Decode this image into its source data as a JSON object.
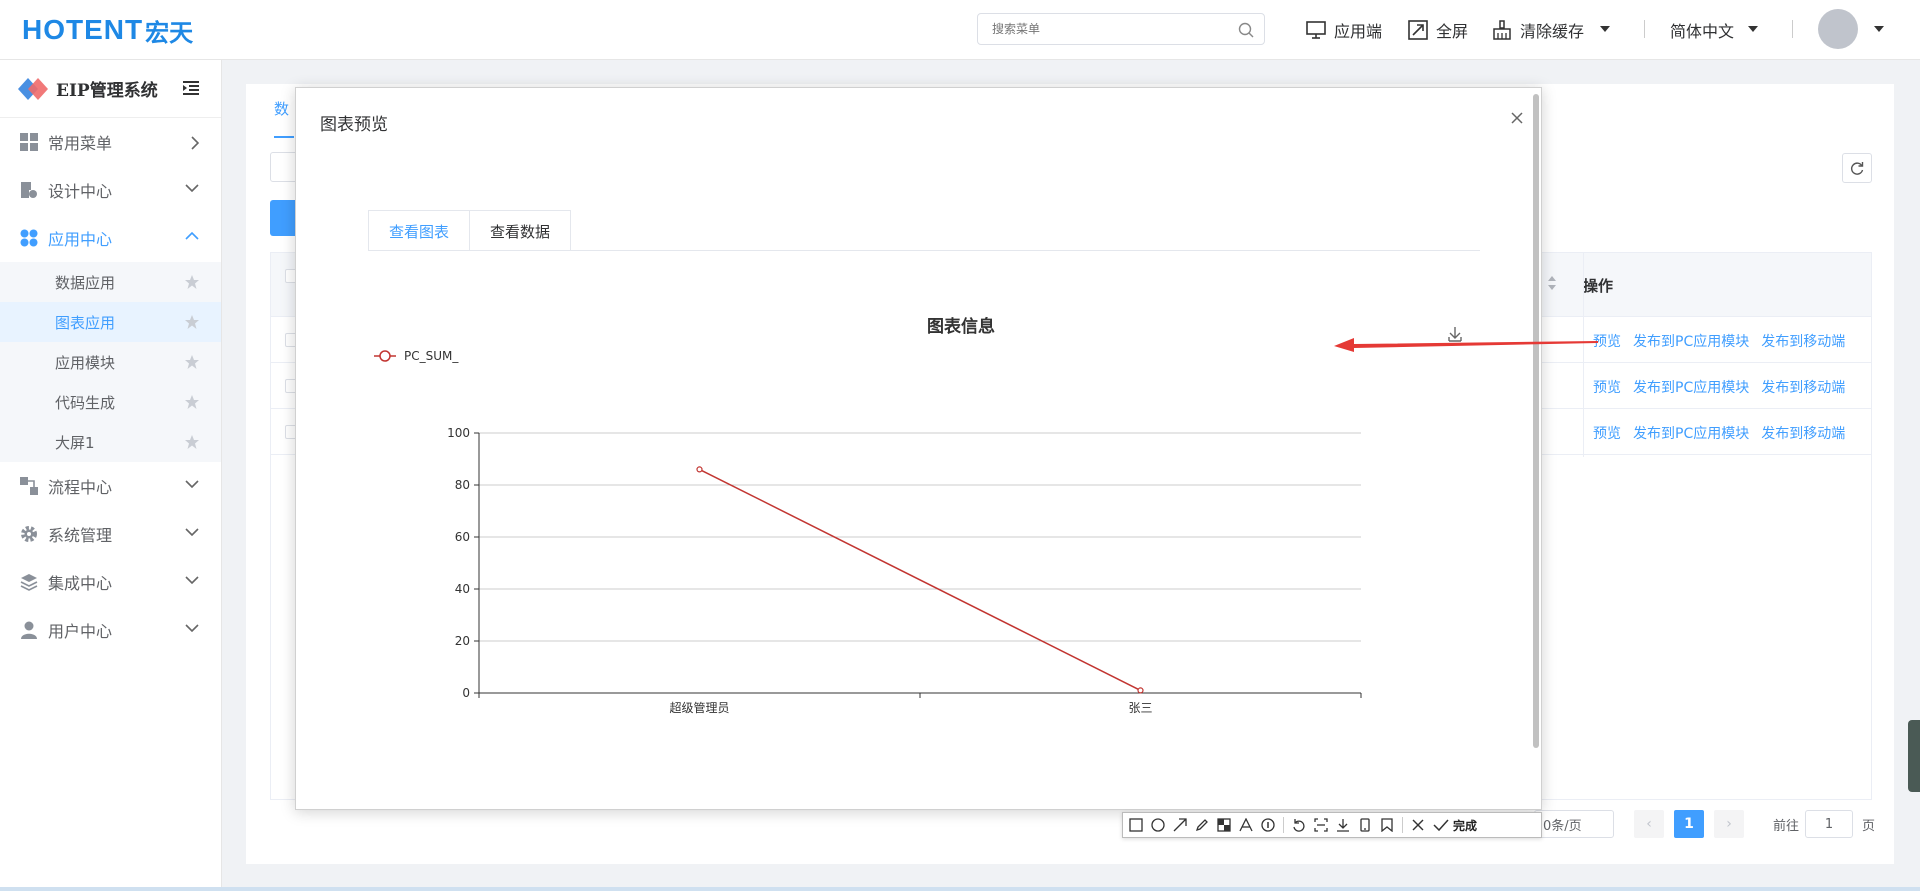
{
  "header": {
    "logo_brand": "HOTENT",
    "logo_cn": "宏天",
    "search_placeholder": "搜索菜单",
    "app_end": "应用端",
    "fullscreen": "全屏",
    "clear_cache": "清除缓存",
    "language": "简体中文"
  },
  "sidebar": {
    "system_title": "EIP管理系统",
    "menus": [
      {
        "label": "常用菜单",
        "icon": "dashboard-icon"
      },
      {
        "label": "设计中心",
        "icon": "design-doc-icon"
      },
      {
        "label": "应用中心",
        "icon": "app-grid-icon",
        "active": true
      },
      {
        "label": "流程中心",
        "icon": "flow-icon"
      },
      {
        "label": "系统管理",
        "icon": "gear-icon"
      },
      {
        "label": "集成中心",
        "icon": "layers-icon"
      },
      {
        "label": "用户中心",
        "icon": "user-icon"
      }
    ],
    "app_center_sub": [
      {
        "label": "数据应用"
      },
      {
        "label": "图表应用",
        "active": true
      },
      {
        "label": "应用模块"
      },
      {
        "label": "代码生成"
      },
      {
        "label": "大屏1"
      }
    ]
  },
  "main": {
    "tab_partial": "数",
    "ops_header": "操作",
    "rows": [
      {
        "preview": "预览",
        "publish_pc": "发布到PC应用模块",
        "publish_mobile": "发布到移动端"
      },
      {
        "preview": "预览",
        "publish_pc": "发布到PC应用模块",
        "publish_mobile": "发布到移动端"
      },
      {
        "preview": "预览",
        "publish_pc": "发布到PC应用模块",
        "publish_mobile": "发布到移动端"
      }
    ],
    "pagination": {
      "page_size": "0条/页",
      "current_page": "1",
      "goto_label": "前往",
      "goto_value": "1",
      "page_suffix": "页"
    }
  },
  "modal": {
    "title": "图表预览",
    "tabs": [
      "查看图表",
      "查看数据"
    ]
  },
  "chart_data": {
    "type": "line",
    "title": "图表信息",
    "categories": [
      "超级管理员",
      "张三"
    ],
    "series": [
      {
        "name": "PC_SUM_",
        "values": [
          86,
          1
        ]
      }
    ],
    "ylim": [
      0,
      100
    ],
    "yticks": [
      0,
      20,
      40,
      60,
      80,
      100
    ],
    "grid": true,
    "legend": "top-left",
    "color": "#c23531"
  },
  "snap_toolbar": {
    "done": "完成"
  }
}
